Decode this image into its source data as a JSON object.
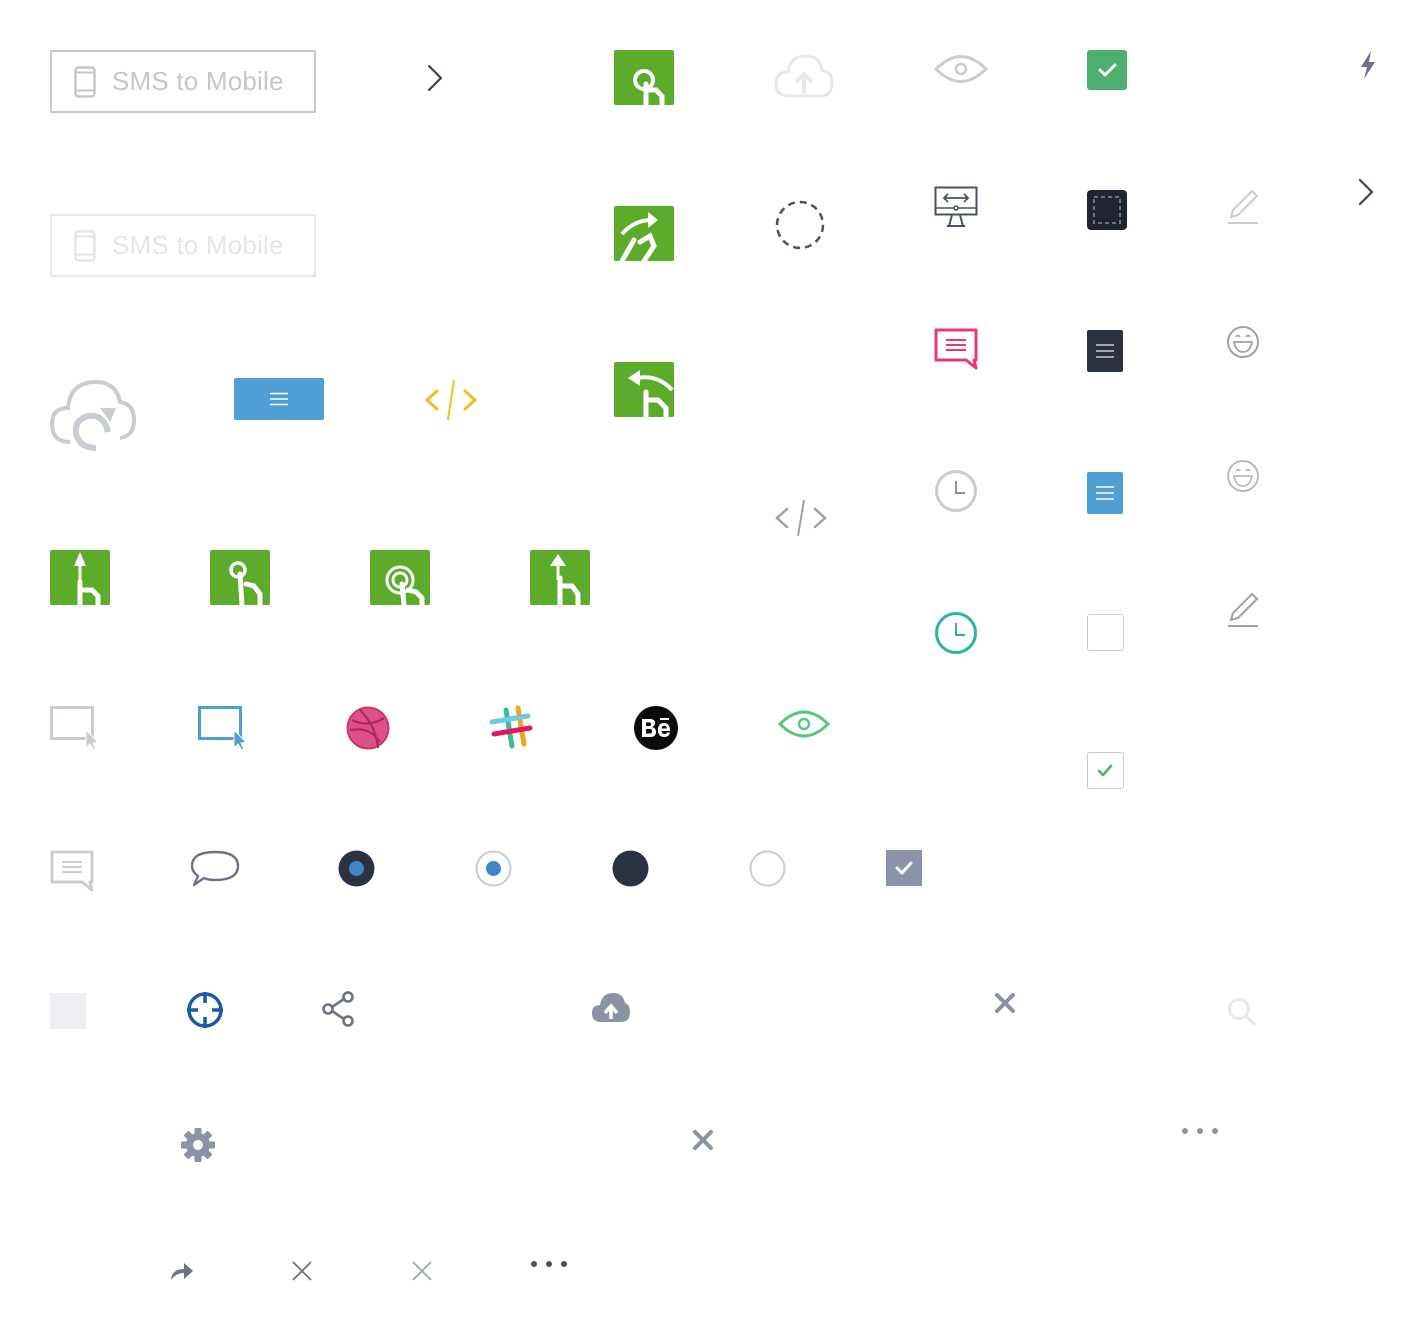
{
  "sms_button": {
    "label": "SMS to Mobile"
  },
  "sms_button_disabled": {
    "label": "SMS to Mobile"
  },
  "colors": {
    "green_tile": "#5cab2b",
    "menu_blue": "#4f9fd4",
    "code_yellow": "#f4be23",
    "check_green": "#4caf6e",
    "dark_navy": "#2a3140",
    "comment_pink": "#e83a70",
    "teal_clock": "#2fb1a6",
    "dribbble_pink": "#e14f89",
    "eye_green": "#55c879",
    "target_blue": "#1b5aa6",
    "icon_gray": "#8a93a3",
    "light_gray": "#c8ccd3"
  },
  "icons": [
    "mobile-phone-icon",
    "chevron-right-icon",
    "tap-gesture-icon",
    "cloud-upload-outline-icon",
    "eye-icon",
    "checkbox-checked-green-icon",
    "lightning-icon",
    "swipe-right-gesture-icon",
    "dashed-circle-icon",
    "monitor-resize-icon",
    "dashed-square-dark-icon",
    "pencil-icon",
    "cloud-refresh-icon",
    "menu-icon",
    "code-icon",
    "swipe-left-gesture-icon",
    "comment-icon",
    "document-icon",
    "smiley-icon",
    "clock-icon",
    "swipe-up-gesture-icon",
    "tap-once-gesture-icon",
    "double-tap-gesture-icon",
    "flick-up-gesture-icon",
    "cursor-window-icon",
    "dribbble-icon",
    "slack-icon",
    "behance-icon",
    "chat-bubble-icon",
    "radio-selected-icon",
    "radio-empty-icon",
    "checkbox-empty-icon",
    "checkbox-checked-gray-icon",
    "square-placeholder-icon",
    "crosshair-icon",
    "share-icon",
    "cloud-upload-filled-icon",
    "close-icon",
    "search-icon",
    "gear-icon",
    "more-dots-icon",
    "forward-arrow-icon"
  ]
}
